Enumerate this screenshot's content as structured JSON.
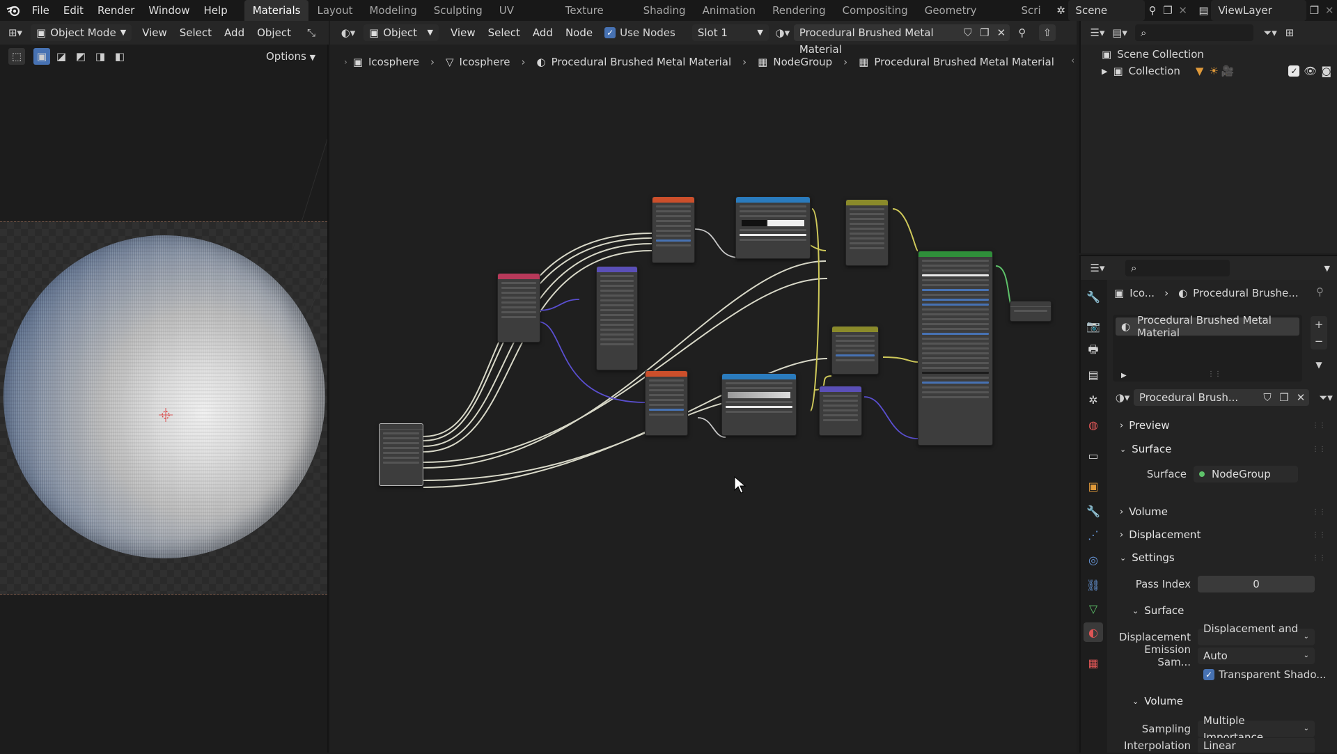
{
  "topbar": {
    "menus": [
      "File",
      "Edit",
      "Render",
      "Window",
      "Help"
    ],
    "workspaces": [
      "Materials",
      "Layout",
      "Modeling",
      "Sculpting",
      "UV Editing",
      "Texture Paint",
      "Shading",
      "Animation",
      "Rendering",
      "Compositing",
      "Geometry Nodes",
      "Scri"
    ],
    "active_workspace": "Materials",
    "scene": "Scene",
    "view_layer": "ViewLayer"
  },
  "viewport": {
    "mode": "Object Mode",
    "menus": [
      "View",
      "Select",
      "Add",
      "Object"
    ],
    "options": "Options"
  },
  "node_editor": {
    "type": "Object",
    "menus": [
      "View",
      "Select",
      "Add",
      "Node"
    ],
    "use_nodes_label": "Use Nodes",
    "use_nodes": true,
    "slot": "Slot 1",
    "material": "Procedural Brushed Metal Material",
    "breadcrumb": [
      "Icosphere",
      "Icosphere",
      "Procedural Brushed Metal Material",
      "NodeGroup",
      "Procedural Brushed Metal Material"
    ]
  },
  "outliner": {
    "scene_collection": "Scene Collection",
    "collection": "Collection"
  },
  "properties": {
    "breadcrumb_object": "Ico...",
    "breadcrumb_material": "Procedural Brushe...",
    "material_slot": "Procedural Brushed Metal Material",
    "material_name": "Procedural Brush...",
    "panels": {
      "preview": "Preview",
      "surface": "Surface",
      "surface_label": "Surface",
      "surface_value": "NodeGroup",
      "volume": "Volume",
      "displacement": "Displacement",
      "settings": "Settings",
      "pass_index_label": "Pass Index",
      "pass_index": "0",
      "surface_sub": "Surface",
      "displacement_label": "Displacement",
      "displacement_value": "Displacement and ...",
      "emission_label": "Emission Sam...",
      "emission_value": "Auto",
      "transparent_shadows": "Transparent Shado...",
      "volume_sub": "Volume",
      "sampling_label": "Sampling",
      "sampling_value": "Multiple Importance",
      "interpolation_label": "Interpolation",
      "interpolation_value": "Linear"
    }
  },
  "colors": {
    "texture_node": "#cc4f2b",
    "converter_node": "#2a7bbd",
    "vector_node": "#5a4fb7",
    "input_node": "#b8395a",
    "shader_node": "#2f8f3a",
    "mix_node": "#8a8a2a",
    "accent": "#4772b3"
  }
}
